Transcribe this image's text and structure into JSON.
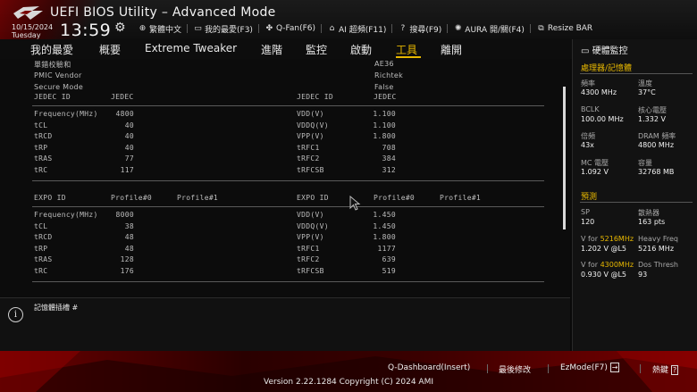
{
  "header": {
    "title": "UEFI BIOS Utility – Advanced Mode",
    "date": "10/15/2024",
    "day": "Tuesday",
    "time": "13:59",
    "toolbar": [
      {
        "icon": "globe-icon",
        "label": "繁體中文"
      },
      {
        "icon": "favorites-icon",
        "label": "我的最愛(F3)"
      },
      {
        "icon": "fan-icon",
        "label": "Q-Fan(F6)"
      },
      {
        "icon": "ai-overclock-icon",
        "label": "AI 超頻(F11)"
      },
      {
        "icon": "search-icon",
        "label": "搜尋(F9)"
      },
      {
        "icon": "aura-icon",
        "label": "AURA 開/關(F4)"
      },
      {
        "icon": "resize-bar-icon",
        "label": "Resize BAR"
      }
    ]
  },
  "nav": {
    "tabs": [
      "我的最愛",
      "概要",
      "Extreme Tweaker",
      "進階",
      "監控",
      "啟動",
      "工具",
      "離開"
    ],
    "active": "工具"
  },
  "main": {
    "top_rows": [
      {
        "label": "單錯校驗和",
        "value": "AE36"
      },
      {
        "label": "PMIC Vendor",
        "value": "Richtek"
      },
      {
        "label": "Secure Mode",
        "value": "False"
      }
    ],
    "jedec": {
      "left_header": [
        "JEDEC ID",
        "JEDEC"
      ],
      "right_header": [
        "JEDEC ID",
        "JEDEC"
      ],
      "left_rows": [
        {
          "label": "Frequency(MHz)",
          "value": "4800"
        },
        {
          "label": "tCL",
          "value": "40"
        },
        {
          "label": "tRCD",
          "value": "40"
        },
        {
          "label": "tRP",
          "value": "40"
        },
        {
          "label": "tRAS",
          "value": "77"
        },
        {
          "label": "tRC",
          "value": "117"
        }
      ],
      "right_rows": [
        {
          "label": "VDD(V)",
          "value": "1.100"
        },
        {
          "label": "VDDQ(V)",
          "value": "1.100"
        },
        {
          "label": "VPP(V)",
          "value": "1.800"
        },
        {
          "label": "tRFC1",
          "value": "708"
        },
        {
          "label": "tRFC2",
          "value": "384"
        },
        {
          "label": "tRFCSB",
          "value": "312"
        }
      ]
    },
    "expo": {
      "left_header": [
        "EXPO ID",
        "Profile#0",
        "Profile#1"
      ],
      "right_header": [
        "EXPO ID",
        "Profile#0",
        "Profile#1"
      ],
      "left_rows": [
        {
          "label": "Frequency(MHz)",
          "value": "8000"
        },
        {
          "label": "tCL",
          "value": "38"
        },
        {
          "label": "tRCD",
          "value": "48"
        },
        {
          "label": "tRP",
          "value": "48"
        },
        {
          "label": "tRAS",
          "value": "128"
        },
        {
          "label": "tRC",
          "value": "176"
        }
      ],
      "right_rows": [
        {
          "label": "VDD(V)",
          "value": "1.450"
        },
        {
          "label": "VDDQ(V)",
          "value": "1.450"
        },
        {
          "label": "VPP(V)",
          "value": "1.800"
        },
        {
          "label": "tRFC1",
          "value": "1177"
        },
        {
          "label": "tRFC2",
          "value": "639"
        },
        {
          "label": "tRFCSB",
          "value": "519"
        }
      ]
    }
  },
  "help": {
    "text": "記憶體插槽 #"
  },
  "hw": {
    "title": "硬體監控",
    "cpu_section": "處理器/記憶體",
    "cpu_items": [
      [
        "頻率",
        "4300 MHz",
        "溫度",
        "37°C"
      ],
      [
        "BCLK",
        "100.00 MHz",
        "核心電壓",
        "1.332 V"
      ],
      [
        "倍頻",
        "43x",
        "DRAM 頻率",
        "4800 MHz"
      ],
      [
        "MC 電壓",
        "1.092 V",
        "容量",
        "32768 MB"
      ]
    ],
    "predict_section": "預測",
    "predict_items": [
      {
        "l1": "SP",
        "v1": "120",
        "l2": "散熱器",
        "v2": "163 pts"
      },
      {
        "l1a": "V for ",
        "l1b": "5216MHz",
        "v1": "1.202 V @L5",
        "l2": "Heavy Freq",
        "v2": "5216 MHz"
      },
      {
        "l1a": "V for ",
        "l1b": "4300MHz",
        "v1": "0.930 V @L5",
        "l2": "Dos Thresh",
        "v2": "93"
      }
    ]
  },
  "footer": {
    "buttons": [
      "Q-Dashboard(Insert)",
      "最後修改",
      "EzMode(F7)",
      "熱鍵"
    ],
    "version": "Version 2.22.1284 Copyright (C) 2024 AMI"
  },
  "colors": {
    "accent": "#e8b800",
    "brand_red": "#8a0000"
  }
}
